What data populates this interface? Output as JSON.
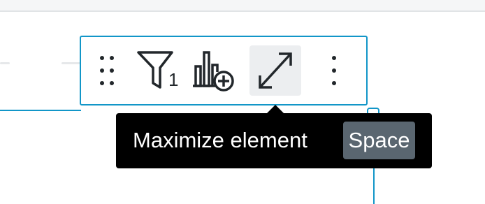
{
  "toolbar": {
    "filter_count": "1",
    "icons": {
      "drag": "drag-handle-icon",
      "filter": "filter-icon",
      "add_chart": "add-chart-icon",
      "maximize": "maximize-icon",
      "more": "more-vertical-icon"
    }
  },
  "tooltip": {
    "label": "Maximize element",
    "shortcut": "Space"
  },
  "colors": {
    "accent": "#1296c8",
    "tooltip_bg": "#000000",
    "shortcut_bg": "#5a6670",
    "active_tool_bg": "#eceef0",
    "icon": "#22272b"
  }
}
